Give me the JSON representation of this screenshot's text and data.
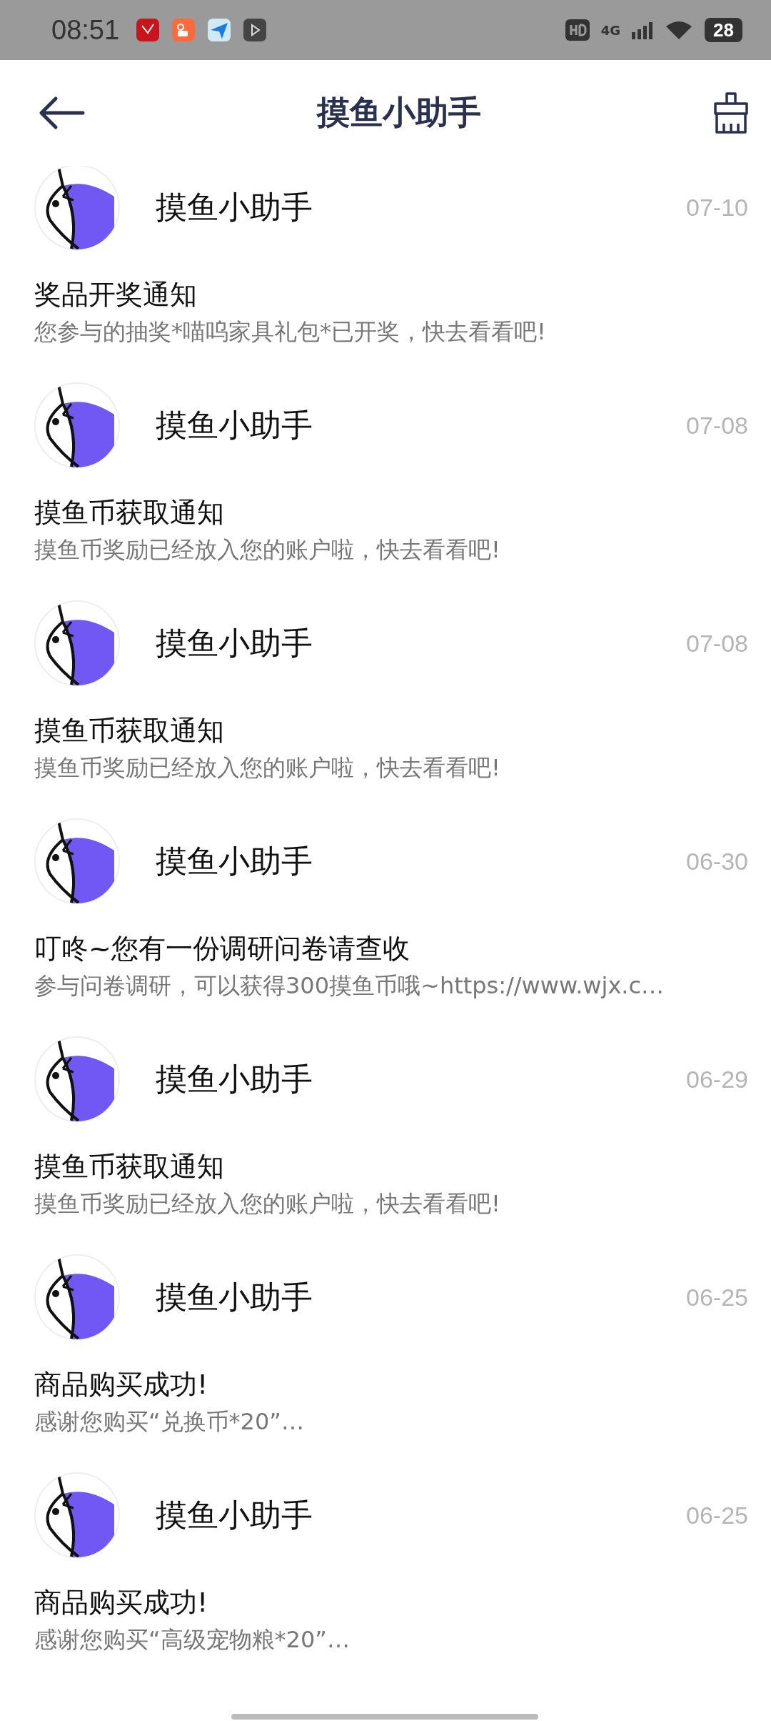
{
  "status_bar": {
    "time": "08:51",
    "network": "4G",
    "battery": "28"
  },
  "header": {
    "title": "摸鱼小助手"
  },
  "messages": [
    {
      "sender": "摸鱼小助手",
      "date": "07-10",
      "title": "奖品开奖通知",
      "preview": "您参与的抽奖*喵呜家具礼包*已开奖，快去看看吧!"
    },
    {
      "sender": "摸鱼小助手",
      "date": "07-08",
      "title": "摸鱼币获取通知",
      "preview": "摸鱼币奖励已经放入您的账户啦，快去看看吧!"
    },
    {
      "sender": "摸鱼小助手",
      "date": "07-08",
      "title": "摸鱼币获取通知",
      "preview": "摸鱼币奖励已经放入您的账户啦，快去看看吧!"
    },
    {
      "sender": "摸鱼小助手",
      "date": "06-30",
      "title": "叮咚~您有一份调研问卷请查收",
      "preview": "参与问卷调研，可以获得300摸鱼币哦~https://www.wjx.c…"
    },
    {
      "sender": "摸鱼小助手",
      "date": "06-29",
      "title": "摸鱼币获取通知",
      "preview": "摸鱼币奖励已经放入您的账户啦，快去看看吧!"
    },
    {
      "sender": "摸鱼小助手",
      "date": "06-25",
      "title": "商品购买成功!",
      "preview": "感谢您购买“兑换币*20”…"
    },
    {
      "sender": "摸鱼小助手",
      "date": "06-25",
      "title": "商品购买成功!",
      "preview": "感谢您购买“高级宠物粮*20”…"
    }
  ]
}
